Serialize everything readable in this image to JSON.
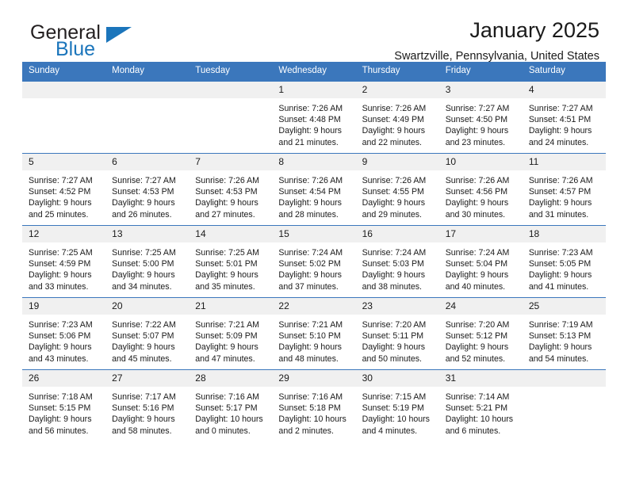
{
  "brand": {
    "name_primary": "General",
    "name_secondary": "Blue",
    "logo_icon": "triangle-logo-icon"
  },
  "header": {
    "title": "January 2025",
    "location": "Swartzville, Pennsylvania, United States"
  },
  "calendar": {
    "weekday_headers": [
      "Sunday",
      "Monday",
      "Tuesday",
      "Wednesday",
      "Thursday",
      "Friday",
      "Saturday"
    ],
    "colors": {
      "header_blue": "#3b77bc",
      "daynum_band": "#f0f0f0",
      "brand_blue": "#1b75bb",
      "text": "#1a1a1a"
    },
    "weeks": [
      [
        {
          "day": "",
          "empty": true,
          "sunrise": "",
          "sunset": "",
          "daylight_line1": "",
          "daylight_line2": ""
        },
        {
          "day": "",
          "empty": true,
          "sunrise": "",
          "sunset": "",
          "daylight_line1": "",
          "daylight_line2": ""
        },
        {
          "day": "",
          "empty": true,
          "sunrise": "",
          "sunset": "",
          "daylight_line1": "",
          "daylight_line2": ""
        },
        {
          "day": "1",
          "empty": false,
          "sunrise": "Sunrise: 7:26 AM",
          "sunset": "Sunset: 4:48 PM",
          "daylight_line1": "Daylight: 9 hours",
          "daylight_line2": "and 21 minutes."
        },
        {
          "day": "2",
          "empty": false,
          "sunrise": "Sunrise: 7:26 AM",
          "sunset": "Sunset: 4:49 PM",
          "daylight_line1": "Daylight: 9 hours",
          "daylight_line2": "and 22 minutes."
        },
        {
          "day": "3",
          "empty": false,
          "sunrise": "Sunrise: 7:27 AM",
          "sunset": "Sunset: 4:50 PM",
          "daylight_line1": "Daylight: 9 hours",
          "daylight_line2": "and 23 minutes."
        },
        {
          "day": "4",
          "empty": false,
          "sunrise": "Sunrise: 7:27 AM",
          "sunset": "Sunset: 4:51 PM",
          "daylight_line1": "Daylight: 9 hours",
          "daylight_line2": "and 24 minutes."
        }
      ],
      [
        {
          "day": "5",
          "empty": false,
          "sunrise": "Sunrise: 7:27 AM",
          "sunset": "Sunset: 4:52 PM",
          "daylight_line1": "Daylight: 9 hours",
          "daylight_line2": "and 25 minutes."
        },
        {
          "day": "6",
          "empty": false,
          "sunrise": "Sunrise: 7:27 AM",
          "sunset": "Sunset: 4:53 PM",
          "daylight_line1": "Daylight: 9 hours",
          "daylight_line2": "and 26 minutes."
        },
        {
          "day": "7",
          "empty": false,
          "sunrise": "Sunrise: 7:26 AM",
          "sunset": "Sunset: 4:53 PM",
          "daylight_line1": "Daylight: 9 hours",
          "daylight_line2": "and 27 minutes."
        },
        {
          "day": "8",
          "empty": false,
          "sunrise": "Sunrise: 7:26 AM",
          "sunset": "Sunset: 4:54 PM",
          "daylight_line1": "Daylight: 9 hours",
          "daylight_line2": "and 28 minutes."
        },
        {
          "day": "9",
          "empty": false,
          "sunrise": "Sunrise: 7:26 AM",
          "sunset": "Sunset: 4:55 PM",
          "daylight_line1": "Daylight: 9 hours",
          "daylight_line2": "and 29 minutes."
        },
        {
          "day": "10",
          "empty": false,
          "sunrise": "Sunrise: 7:26 AM",
          "sunset": "Sunset: 4:56 PM",
          "daylight_line1": "Daylight: 9 hours",
          "daylight_line2": "and 30 minutes."
        },
        {
          "day": "11",
          "empty": false,
          "sunrise": "Sunrise: 7:26 AM",
          "sunset": "Sunset: 4:57 PM",
          "daylight_line1": "Daylight: 9 hours",
          "daylight_line2": "and 31 minutes."
        }
      ],
      [
        {
          "day": "12",
          "empty": false,
          "sunrise": "Sunrise: 7:25 AM",
          "sunset": "Sunset: 4:59 PM",
          "daylight_line1": "Daylight: 9 hours",
          "daylight_line2": "and 33 minutes."
        },
        {
          "day": "13",
          "empty": false,
          "sunrise": "Sunrise: 7:25 AM",
          "sunset": "Sunset: 5:00 PM",
          "daylight_line1": "Daylight: 9 hours",
          "daylight_line2": "and 34 minutes."
        },
        {
          "day": "14",
          "empty": false,
          "sunrise": "Sunrise: 7:25 AM",
          "sunset": "Sunset: 5:01 PM",
          "daylight_line1": "Daylight: 9 hours",
          "daylight_line2": "and 35 minutes."
        },
        {
          "day": "15",
          "empty": false,
          "sunrise": "Sunrise: 7:24 AM",
          "sunset": "Sunset: 5:02 PM",
          "daylight_line1": "Daylight: 9 hours",
          "daylight_line2": "and 37 minutes."
        },
        {
          "day": "16",
          "empty": false,
          "sunrise": "Sunrise: 7:24 AM",
          "sunset": "Sunset: 5:03 PM",
          "daylight_line1": "Daylight: 9 hours",
          "daylight_line2": "and 38 minutes."
        },
        {
          "day": "17",
          "empty": false,
          "sunrise": "Sunrise: 7:24 AM",
          "sunset": "Sunset: 5:04 PM",
          "daylight_line1": "Daylight: 9 hours",
          "daylight_line2": "and 40 minutes."
        },
        {
          "day": "18",
          "empty": false,
          "sunrise": "Sunrise: 7:23 AM",
          "sunset": "Sunset: 5:05 PM",
          "daylight_line1": "Daylight: 9 hours",
          "daylight_line2": "and 41 minutes."
        }
      ],
      [
        {
          "day": "19",
          "empty": false,
          "sunrise": "Sunrise: 7:23 AM",
          "sunset": "Sunset: 5:06 PM",
          "daylight_line1": "Daylight: 9 hours",
          "daylight_line2": "and 43 minutes."
        },
        {
          "day": "20",
          "empty": false,
          "sunrise": "Sunrise: 7:22 AM",
          "sunset": "Sunset: 5:07 PM",
          "daylight_line1": "Daylight: 9 hours",
          "daylight_line2": "and 45 minutes."
        },
        {
          "day": "21",
          "empty": false,
          "sunrise": "Sunrise: 7:21 AM",
          "sunset": "Sunset: 5:09 PM",
          "daylight_line1": "Daylight: 9 hours",
          "daylight_line2": "and 47 minutes."
        },
        {
          "day": "22",
          "empty": false,
          "sunrise": "Sunrise: 7:21 AM",
          "sunset": "Sunset: 5:10 PM",
          "daylight_line1": "Daylight: 9 hours",
          "daylight_line2": "and 48 minutes."
        },
        {
          "day": "23",
          "empty": false,
          "sunrise": "Sunrise: 7:20 AM",
          "sunset": "Sunset: 5:11 PM",
          "daylight_line1": "Daylight: 9 hours",
          "daylight_line2": "and 50 minutes."
        },
        {
          "day": "24",
          "empty": false,
          "sunrise": "Sunrise: 7:20 AM",
          "sunset": "Sunset: 5:12 PM",
          "daylight_line1": "Daylight: 9 hours",
          "daylight_line2": "and 52 minutes."
        },
        {
          "day": "25",
          "empty": false,
          "sunrise": "Sunrise: 7:19 AM",
          "sunset": "Sunset: 5:13 PM",
          "daylight_line1": "Daylight: 9 hours",
          "daylight_line2": "and 54 minutes."
        }
      ],
      [
        {
          "day": "26",
          "empty": false,
          "sunrise": "Sunrise: 7:18 AM",
          "sunset": "Sunset: 5:15 PM",
          "daylight_line1": "Daylight: 9 hours",
          "daylight_line2": "and 56 minutes."
        },
        {
          "day": "27",
          "empty": false,
          "sunrise": "Sunrise: 7:17 AM",
          "sunset": "Sunset: 5:16 PM",
          "daylight_line1": "Daylight: 9 hours",
          "daylight_line2": "and 58 minutes."
        },
        {
          "day": "28",
          "empty": false,
          "sunrise": "Sunrise: 7:16 AM",
          "sunset": "Sunset: 5:17 PM",
          "daylight_line1": "Daylight: 10 hours",
          "daylight_line2": "and 0 minutes."
        },
        {
          "day": "29",
          "empty": false,
          "sunrise": "Sunrise: 7:16 AM",
          "sunset": "Sunset: 5:18 PM",
          "daylight_line1": "Daylight: 10 hours",
          "daylight_line2": "and 2 minutes."
        },
        {
          "day": "30",
          "empty": false,
          "sunrise": "Sunrise: 7:15 AM",
          "sunset": "Sunset: 5:19 PM",
          "daylight_line1": "Daylight: 10 hours",
          "daylight_line2": "and 4 minutes."
        },
        {
          "day": "31",
          "empty": false,
          "sunrise": "Sunrise: 7:14 AM",
          "sunset": "Sunset: 5:21 PM",
          "daylight_line1": "Daylight: 10 hours",
          "daylight_line2": "and 6 minutes."
        },
        {
          "day": "",
          "empty": true,
          "sunrise": "",
          "sunset": "",
          "daylight_line1": "",
          "daylight_line2": ""
        }
      ]
    ]
  }
}
